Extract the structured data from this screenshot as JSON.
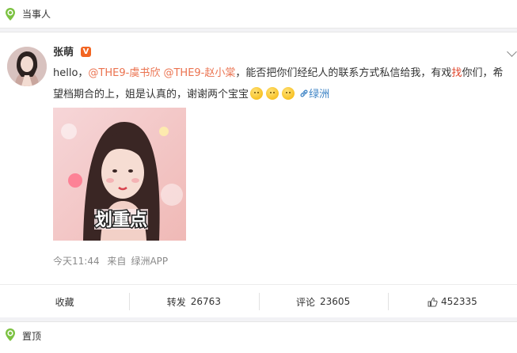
{
  "top_section": {
    "title": "当事人",
    "icon": "location-pin-icon"
  },
  "post": {
    "username": "张萌",
    "verified_badge": "V",
    "text_prefix": "hello，",
    "mention1_handle": "@THE9-",
    "mention1_name": "虞书欣",
    "mention2_handle": "@THE9-",
    "mention2_name": "赵小棠",
    "text_mid1": "，能否把你们经纪人的联系方式私信给我，有戏",
    "text_hl": "找",
    "text_mid2": "你们，希望档期合的上，姐是认真的，谢谢两个宝宝",
    "link_icon": "link-icon",
    "link_text": "绿洲",
    "image_caption": "划重点",
    "timestamp": "今天11:44",
    "source_label": "来自",
    "source_app": "绿洲APP"
  },
  "actions": {
    "favorite_label": "收藏",
    "repost_label": "转发",
    "repost_count": "26763",
    "comment_label": "评论",
    "comment_count": "23605",
    "like_count": "452335"
  },
  "bottom_section": {
    "title": "置顶",
    "icon": "location-pin-icon"
  },
  "colors": {
    "accent_green": "#7cc242",
    "mention": "#eb7350",
    "link": "#3c83c5"
  }
}
